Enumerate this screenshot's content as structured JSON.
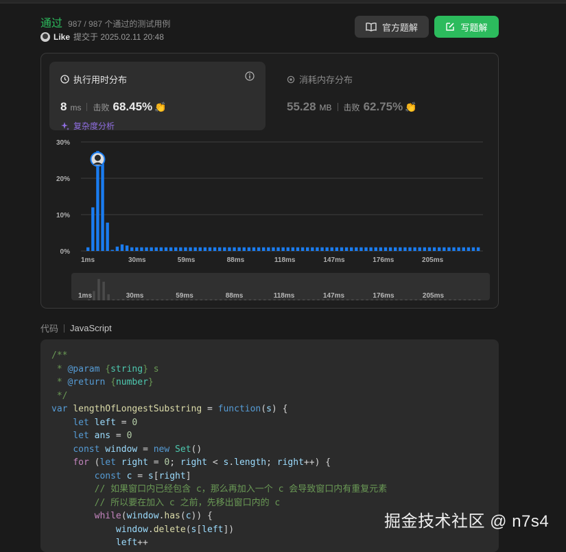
{
  "header": {
    "status": "通过",
    "cases": "987 / 987 个通过的测试用例",
    "user": "Like",
    "submitted": "提交于 2025.02.11 20:48",
    "btn_solution": "官方题解",
    "btn_write": "写题解"
  },
  "runtime": {
    "title": "执行用时分布",
    "value": "8",
    "unit": "ms",
    "beats_label": "击败",
    "beats": "68.45%",
    "analysis": "复杂度分析"
  },
  "memory": {
    "title": "消耗内存分布",
    "value": "55.28",
    "unit": "MB",
    "beats_label": "击败",
    "beats": "62.75%"
  },
  "colors": {
    "accent_green": "#2cbb5d",
    "bar_blue": "#1a7cf0",
    "purple": "#8f6ee0"
  },
  "chart_data": {
    "type": "bar",
    "y_ticks": [
      "30%",
      "20%",
      "10%",
      "0%"
    ],
    "ylim": [
      0,
      30
    ],
    "x_ticks": [
      "1ms",
      "30ms",
      "59ms",
      "88ms",
      "118ms",
      "147ms",
      "176ms",
      "205ms"
    ],
    "values": [
      1.0,
      12.0,
      27.5,
      24.0,
      7.8,
      0.3,
      1.2,
      1.8,
      1.5,
      1.0,
      1.0,
      1.0,
      1.0,
      1.0,
      1.0,
      1.0,
      1.0,
      1.0,
      1.0,
      1.0,
      1.0,
      1.0,
      1.0,
      1.0,
      1.0,
      1.0,
      1.0,
      1.0,
      1.0,
      1.0,
      1.0,
      1.0,
      1.0,
      1.0,
      1.0,
      1.0,
      1.0,
      1.0,
      1.0,
      1.0,
      1.0,
      1.0,
      1.0,
      1.0,
      1.0,
      1.0,
      1.0,
      1.0,
      1.0,
      1.0,
      1.0,
      1.0,
      1.0,
      1.0,
      1.0,
      1.0,
      1.0,
      1.0,
      1.0,
      1.0,
      1.0,
      1.0,
      1.0,
      1.0,
      1.0,
      1.0,
      1.0,
      1.0,
      1.0,
      1.0,
      1.0,
      1.0,
      1.0,
      1.0,
      1.0,
      1.0,
      1.0,
      1.0,
      1.0,
      1.0,
      1.0
    ],
    "marker_bar_index": 2
  },
  "code": {
    "tab_label": "代码",
    "language": "JavaScript",
    "lines": [
      "/**",
      " * @param {string} s",
      " * @return {number}",
      " */",
      "var lengthOfLongestSubstring = function(s) {",
      "    let left = 0",
      "    let ans = 0",
      "    const window = new Set()",
      "    for (let right = 0; right < s.length; right++) {",
      "        const c = s[right]",
      "        // 如果窗口内已经包含 c，那么再加入一个 c 会导致窗口内有重复元素",
      "        // 所以要在加入 c 之前，先移出窗口内的 c",
      "        while(window.has(c)) {",
      "            window.delete(s[left])",
      "            left++"
    ]
  },
  "watermark": "掘金技术社区 @ n7s4"
}
